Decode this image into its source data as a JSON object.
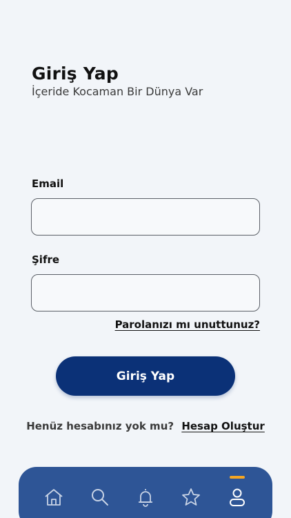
{
  "header": {
    "title": "Giriş Yap",
    "subtitle": "İçeride Kocaman Bir Dünya Var"
  },
  "form": {
    "email_label": "Email",
    "email_value": "",
    "password_label": "Şifre",
    "password_value": "",
    "forgot_password": "Parolanızı mı unuttunuz?",
    "submit_label": "Giriş Yap"
  },
  "signup": {
    "prompt": "Henüz hesabınız yok mu?",
    "link": "Hesap Oluştur"
  },
  "tabbar": {
    "items": [
      {
        "icon": "home-icon"
      },
      {
        "icon": "search-icon"
      },
      {
        "icon": "bell-icon"
      },
      {
        "icon": "star-icon"
      },
      {
        "icon": "profile-icon",
        "active": true
      }
    ],
    "active_color": "#f5a623",
    "background": "#2e5596"
  },
  "colors": {
    "primary": "#0b3177",
    "background": "#f2f5f9"
  }
}
